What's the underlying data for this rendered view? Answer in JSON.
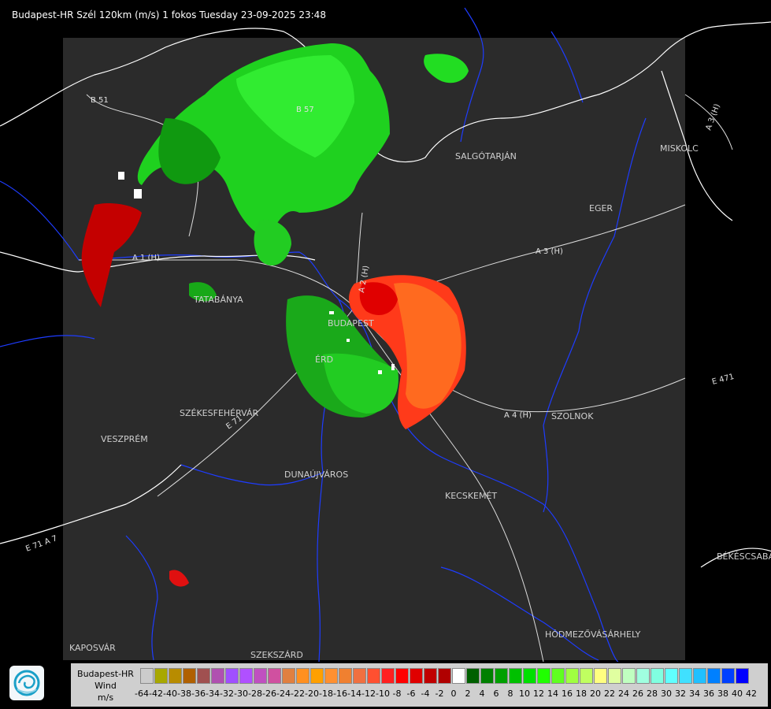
{
  "header": {
    "title": "Budapest-HR Szél 120km (m/s) 1 fokos Tuesday 23-09-2025 23:48"
  },
  "map": {
    "background_color": "#000000",
    "domain_color": "#2b2b2b",
    "river_color": "#1e3cff",
    "border_color": "#ffffff",
    "road_color": "#e6e6e6",
    "cities": [
      {
        "id": "salgotarjan",
        "name": "SALGÓTARJÁN"
      },
      {
        "id": "miskolc",
        "name": "MISKOLC"
      },
      {
        "id": "eger",
        "name": "EGER"
      },
      {
        "id": "tatabanya",
        "name": "TATABÁNYA"
      },
      {
        "id": "budapest",
        "name": "BUDAPEST"
      },
      {
        "id": "erd",
        "name": "ÉRD"
      },
      {
        "id": "szekesfehervar",
        "name": "SZÉKESFEHÉRVÁR"
      },
      {
        "id": "veszprem",
        "name": "VESZPRÉM"
      },
      {
        "id": "szolnok",
        "name": "SZOLNOK"
      },
      {
        "id": "dunaujvaros",
        "name": "DUNAÚJVÁROS"
      },
      {
        "id": "kecskemet",
        "name": "KECSKEMÉT"
      },
      {
        "id": "bekescsaba",
        "name": "BÉKÉSCSABA"
      },
      {
        "id": "hodmezovasarhely",
        "name": "HÓDMEZŐVÁSÁRHELY"
      },
      {
        "id": "kaposvar",
        "name": "KAPOSVÁR"
      },
      {
        "id": "szekszard",
        "name": "SZEKSZÁRD"
      }
    ],
    "road_labels": [
      {
        "id": "b51",
        "text": "B 51"
      },
      {
        "id": "b57",
        "text": "B 57"
      },
      {
        "id": "a1",
        "text": "A 1 (H)"
      },
      {
        "id": "a2",
        "text": "A 2 (H)"
      },
      {
        "id": "a3",
        "text": "A 3 (H)"
      },
      {
        "id": "a3ne",
        "text": "A 3 (H)"
      },
      {
        "id": "a4",
        "text": "A 4 (H)"
      },
      {
        "id": "e71",
        "text": "E 71"
      },
      {
        "id": "e71sw",
        "text": "E 71 A 7"
      },
      {
        "id": "e471",
        "text": "E 471"
      }
    ]
  },
  "legend": {
    "line1": "Budapest-HR",
    "line2": "Wind",
    "line3": "m/s",
    "colors": [
      "#cccccc",
      "#a8a800",
      "#b88c00",
      "#b06000",
      "#a05050",
      "#b050b0",
      "#a050ff",
      "#b050ff",
      "#c050c0",
      "#d050a0",
      "#e08040",
      "#ff9020",
      "#ffa000",
      "#ff9030",
      "#f08030",
      "#f07040",
      "#ff5030",
      "#ff2020",
      "#ff0000",
      "#e00000",
      "#c00000",
      "#b00000",
      "#ffffff",
      "#006000",
      "#008000",
      "#00a000",
      "#00c000",
      "#00e000",
      "#20ff00",
      "#60ff20",
      "#a0ff40",
      "#c0ff60",
      "#ffff80",
      "#e0ffa0",
      "#c0ffc0",
      "#a0ffe0",
      "#80ffe0",
      "#60ffff",
      "#40e0ff",
      "#20c0ff",
      "#0080ff",
      "#0040ff",
      "#0000ff"
    ],
    "labels": [
      "-64",
      "-42",
      "-40",
      "-38",
      "-36",
      "-34",
      "-32",
      "-30",
      "-28",
      "-26",
      "-24",
      "-22",
      "-20",
      "-18",
      "-16",
      "-14",
      "-12",
      "-10",
      "-8",
      "-6",
      "-4",
      "-2",
      "0",
      "2",
      "4",
      "6",
      "8",
      "10",
      "12",
      "14",
      "16",
      "18",
      "20",
      "22",
      "24",
      "26",
      "28",
      "30",
      "32",
      "34",
      "36",
      "38",
      "40",
      "42"
    ]
  }
}
